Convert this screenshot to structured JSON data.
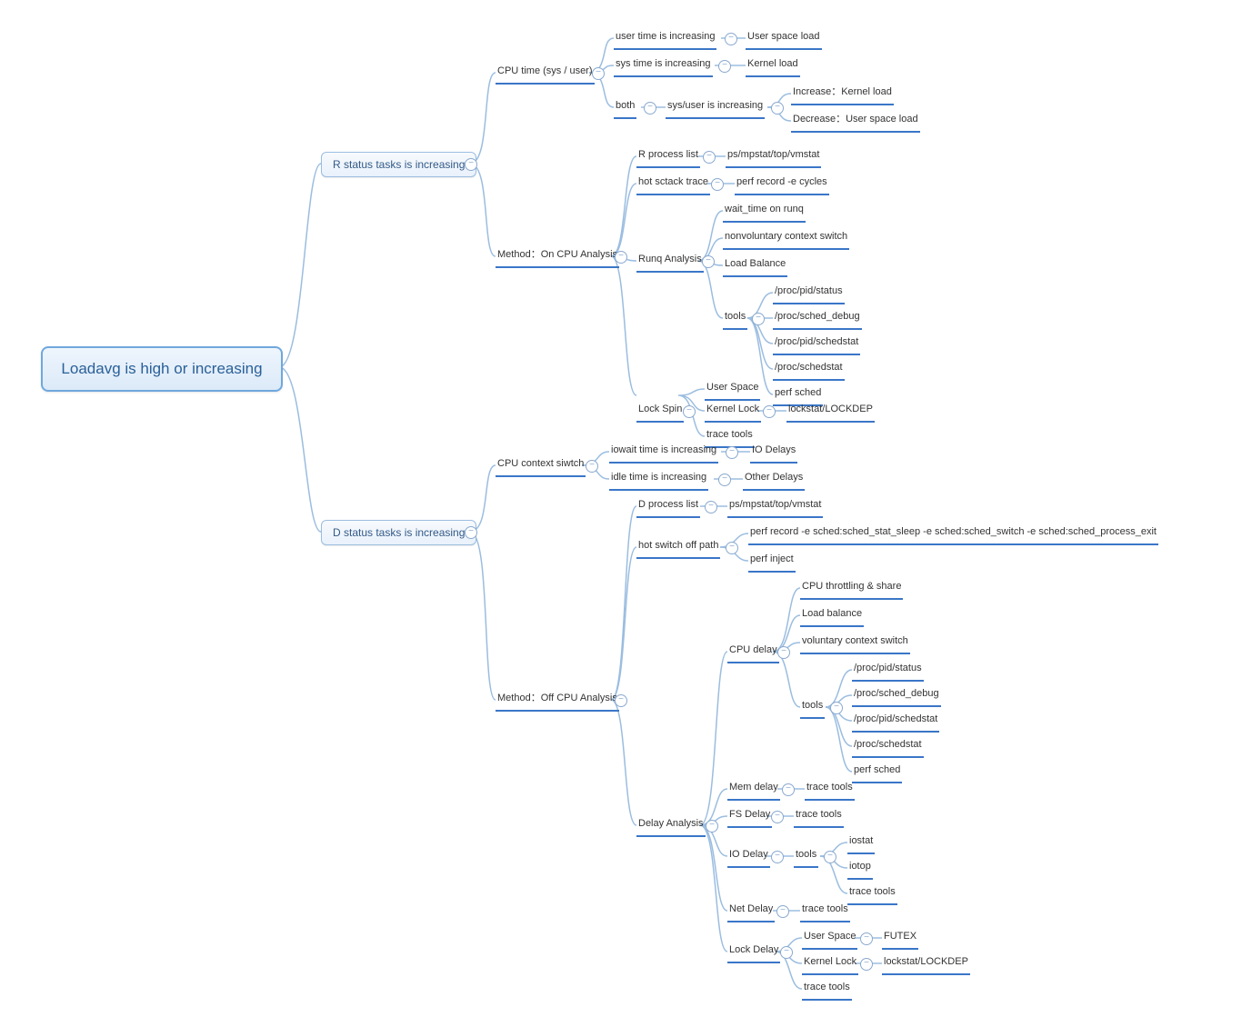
{
  "root": "Loadavg is high or increasing",
  "b1": "R status tasks is increasing",
  "b2": "D status tasks is increasing",
  "r_cpu_time": "CPU time (sys / user)",
  "r_user_inc": "user time is increasing",
  "r_user_load": "User space load",
  "r_sys_inc": "sys time is increasing",
  "r_kernel": "Kernel load",
  "r_both": "both",
  "r_sysuser": "sys/user is increasing",
  "r_inc_kernel": "Increase：Kernel load",
  "r_dec_user": "Decrease：User space load",
  "r_method": "Method：On CPU Analysis",
  "r_proclist": "R process list",
  "r_ps": "ps/mpstat/top/vmstat",
  "r_hotstack": "hot sctack trace",
  "r_perfrec": "perf record -e cycles",
  "r_runq": "Runq Analysis",
  "r_wait": "wait_time on runq",
  "r_nonvol": "nonvoluntary context switch",
  "r_loadbal": "Load Balance",
  "r_tools": "tools",
  "r_t1": "/proc/pid/status",
  "r_t2": "/proc/sched_debug",
  "r_t3": "/proc/pid/schedstat",
  "r_t4": "/proc/schedstat",
  "r_t5": "perf sched",
  "r_lockspin": "Lock Spin",
  "r_us": "User Space",
  "r_kl": "Kernel Lock",
  "r_lockstat": "lockstat/LOCKDEP",
  "r_tracetools": "trace tools",
  "d_ctx": "CPU context siwtch",
  "d_iowait": "iowait time is increasing",
  "d_iodelays": "IO  Delays",
  "d_idle": "idle time is increasing",
  "d_other": "Other Delays",
  "d_method": "Method：Off CPU Analysis",
  "d_proclist": "D process list",
  "d_ps": "ps/mpstat/top/vmstat",
  "d_hotsw": "hot switch off path",
  "d_perf1": "perf record -e sched:sched_stat_sleep -e sched:sched_switch  -e sched:sched_process_exit",
  "d_perf2": "perf inject",
  "d_delayan": "Delay Analysis",
  "d_cpudelay": "CPU delay",
  "d_throt": "CPU throttling & share",
  "d_loadbal": "Load balance",
  "d_vol": "voluntary context switch",
  "d_tools": "tools",
  "d_t1": "/proc/pid/status",
  "d_t2": "/proc/sched_debug",
  "d_t3": "/proc/pid/schedstat",
  "d_t4": "/proc/schedstat",
  "d_t5": "perf sched",
  "d_mem": "Mem delay",
  "d_trace": "trace tools",
  "d_fs": "FS Delay",
  "d_trace2": "trace tools",
  "d_io": "IO Delay",
  "d_iotools": "tools",
  "d_iostat": "iostat",
  "d_iotop": "iotop",
  "d_trace3": "trace tools",
  "d_net": "Net Delay",
  "d_trace4": "trace tools",
  "d_lock": "Lock Delay",
  "d_us2": "User Space",
  "d_futex": "FUTEX",
  "d_kl2": "Kernel Lock",
  "d_lockstat2": "lockstat/LOCKDEP",
  "d_trace5": "trace tools",
  "toggle_glyph": "−"
}
